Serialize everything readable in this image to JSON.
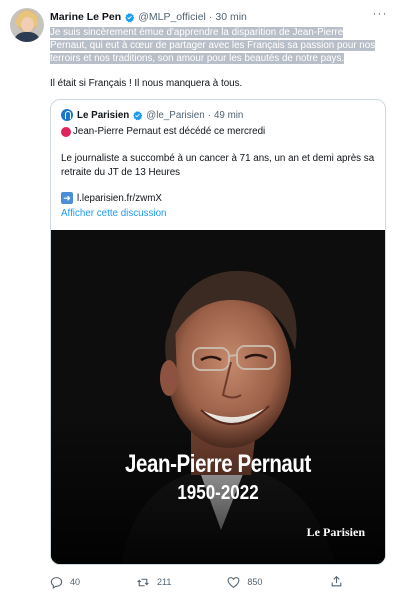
{
  "tweet": {
    "author_name": "Marine Le Pen",
    "author_handle": "@MLP_officiel",
    "separator": "·",
    "time": "30 min",
    "text_highlighted": "Je suis sincèrement émue d'apprendre la disparition de Jean-Pierre Pernaut, qui eut à cœur de partager avec les Français sa passion pour nos terroirs et nos traditions, son amour pour les beautés de notre pays.",
    "text_second": "Il était si Français ! Il nous manquera à tous."
  },
  "quoted": {
    "author_name": "Le Parisien",
    "author_handle": "@le_Parisien",
    "separator": "·",
    "time": "49 min",
    "headline": "Jean-Pierre Pernaut est décédé ce mercredi",
    "body": "Le journaliste a succombé à un cancer à 71 ans, un an et demi après sa retraite du JT de 13 Heures",
    "link_text": "l.leparisien.fr/zwmX",
    "show_thread": "Afficher cette discussion",
    "image": {
      "title": "Jean-Pierre Pernaut",
      "years": "1950-2022",
      "brand": "Le Parisien"
    }
  },
  "actions": {
    "replies": "40",
    "retweets": "211",
    "likes": "850"
  },
  "colors": {
    "accent": "#1d9bf0",
    "secondary_text": "#536471",
    "highlight": "#b9bfc8"
  },
  "icons": [
    "verified-badge-icon",
    "more-icon",
    "reply-icon",
    "retweet-icon",
    "like-icon",
    "share-icon"
  ]
}
